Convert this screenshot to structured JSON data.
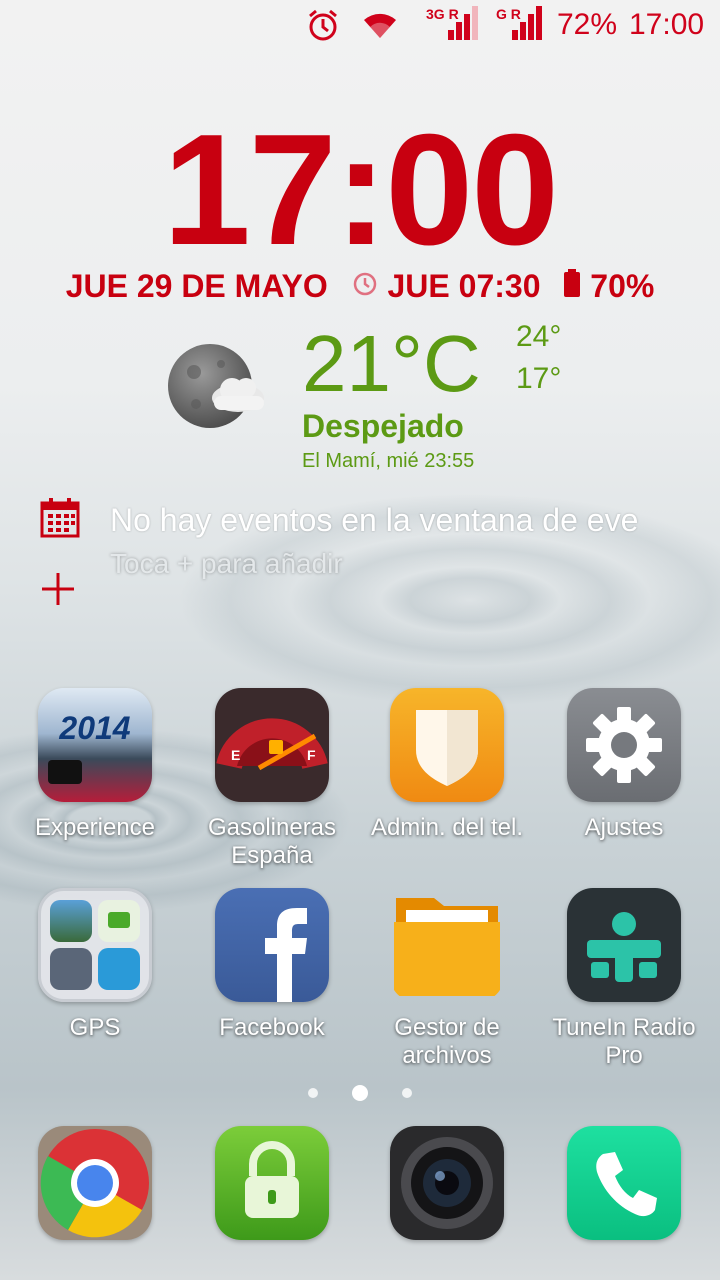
{
  "status_bar": {
    "icons": [
      "alarm-icon",
      "wifi-icon",
      "signal-3g-icon",
      "signal-g-icon"
    ],
    "net1_label": "3G",
    "net2_label": "G",
    "roaming_label": "R",
    "battery": "72%",
    "time": "17:00",
    "accent": "#d0021b"
  },
  "clock_widget": {
    "time": "17:00",
    "date": "JUE 29 DE MAYO",
    "alarm": "JUE 07:30",
    "battery": "70%",
    "color": "#c80010"
  },
  "weather_widget": {
    "icon": "moon-cloud-icon",
    "temperature": "21°C",
    "high": "24°",
    "low": "17°",
    "condition": "Despejado",
    "location_time": "El Mamí, mié 23:55",
    "color": "#5c9a14"
  },
  "calendar_widget": {
    "message": "No hay eventos en la ventana de eve",
    "hint": "Toca + para añadir"
  },
  "apps": [
    {
      "label": "Experience",
      "icon": "motogp-2014-icon",
      "badge_text": "2014"
    },
    {
      "label": "Gasolineras España",
      "icon": "fuel-gauge-icon"
    },
    {
      "label": "Admin. del tel.",
      "icon": "shield-icon"
    },
    {
      "label": "Ajustes",
      "icon": "gear-icon"
    },
    {
      "label": "GPS",
      "icon": "folder-icon"
    },
    {
      "label": "Facebook",
      "icon": "facebook-icon"
    },
    {
      "label": "Gestor de archivos",
      "icon": "file-folder-icon"
    },
    {
      "label": "TuneIn Radio Pro",
      "icon": "tunein-icon"
    }
  ],
  "page_indicator": {
    "pages": 3,
    "current": 2
  },
  "dock": [
    {
      "icon": "chrome-icon"
    },
    {
      "icon": "lock-icon"
    },
    {
      "icon": "camera-icon"
    },
    {
      "icon": "phone-icon"
    }
  ]
}
